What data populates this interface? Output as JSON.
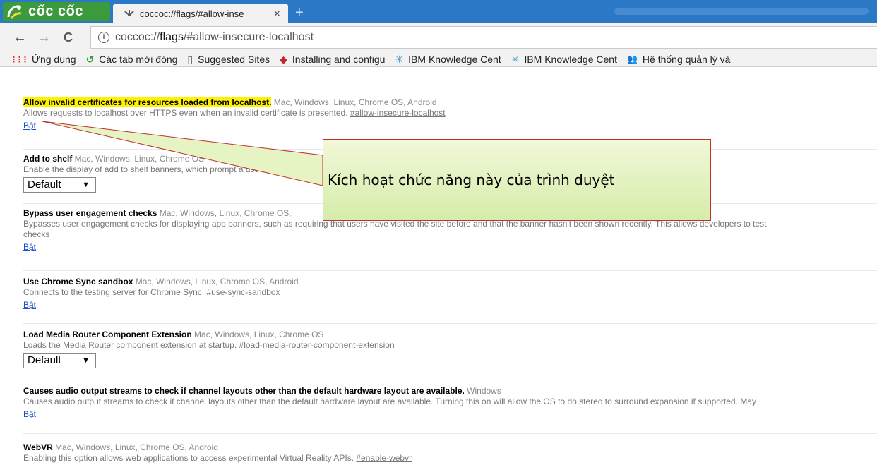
{
  "browser": {
    "brand": "cốc cốc",
    "tab_title": "coccoc://flags/#allow-inse",
    "tab_close": "×",
    "new_tab": "+",
    "url_prefix": "coccoc://",
    "url_host": "flags",
    "url_path": "/#allow-insecure-localhost",
    "back": "←",
    "forward": "→",
    "reload": "C"
  },
  "bookmarks": [
    {
      "icon": "apps-grid-icon",
      "glyph": "⋮⋮⋮",
      "label": "Ứng dụng"
    },
    {
      "icon": "recent-tabs-icon",
      "glyph": "↺",
      "label": "Các tab mới đóng"
    },
    {
      "icon": "page-icon",
      "glyph": "▯",
      "label": "Suggested Sites"
    },
    {
      "icon": "installing-icon",
      "glyph": "◆",
      "label": "Installing and configu"
    },
    {
      "icon": "ibm-icon",
      "glyph": "✳",
      "label": "IBM Knowledge Cent"
    },
    {
      "icon": "ibm-icon",
      "glyph": "✳",
      "label": "IBM Knowledge Cent"
    },
    {
      "icon": "people-icon",
      "glyph": "👥",
      "label": "Hệ thống quản lý và"
    }
  ],
  "flags": [
    {
      "title": "Allow invalid certificates for resources loaded from localhost.",
      "platforms": "Mac, Windows, Linux, Chrome OS, Android",
      "desc": "Allows requests to localhost over HTTPS even when an invalid certificate is presented. ",
      "hash": "#allow-insecure-localhost",
      "action": "Bật"
    },
    {
      "title": "Add to shelf",
      "platforms": "Mac, Windows, Linux, Chrome OS",
      "desc": "Enable the display of add to shelf banners, which prompt a use",
      "select": "Default"
    },
    {
      "title": "Bypass user engagement checks",
      "platforms": "Mac, Windows, Linux, Chrome OS,",
      "desc": "Bypasses user engagement checks for displaying app banners, such as requiring that users have visited the site before and that the banner hasn't been shown recently. This allows developers to test",
      "desc2": "checks",
      "action": "Bật"
    },
    {
      "title": "Use Chrome Sync sandbox",
      "platforms": "Mac, Windows, Linux, Chrome OS, Android",
      "desc": "Connects to the testing server for Chrome Sync. ",
      "hash": "#use-sync-sandbox",
      "action": "Bật"
    },
    {
      "title": "Load Media Router Component Extension",
      "platforms": "Mac, Windows, Linux, Chrome OS",
      "desc": "Loads the Media Router component extension at startup. ",
      "hash": "#load-media-router-component-extension",
      "select": "Default"
    },
    {
      "title": "Causes audio output streams to check if channel layouts other than the default hardware layout are available.",
      "platforms": "Windows",
      "desc": "Causes audio output streams to check if channel layouts other than the default hardware layout are available. Turning this on will allow the OS to do stereo to surround expansion if supported. May",
      "action": "Bật"
    },
    {
      "title": "WebVR",
      "platforms": "Mac, Windows, Linux, Chrome OS, Android",
      "desc": "Enabling this option allows web applications to access experimental Virtual Reality APIs. ",
      "hash": "#enable-webvr"
    }
  ],
  "callout": {
    "text": "Kích hoạt chức năng này của trình duyệt"
  },
  "colors": {
    "tabstrip": "#2b78c6",
    "logo_green": "#3b9a3b",
    "highlight": "#fff200",
    "link": "#1a4fcf",
    "callout_border": "#c03030"
  }
}
